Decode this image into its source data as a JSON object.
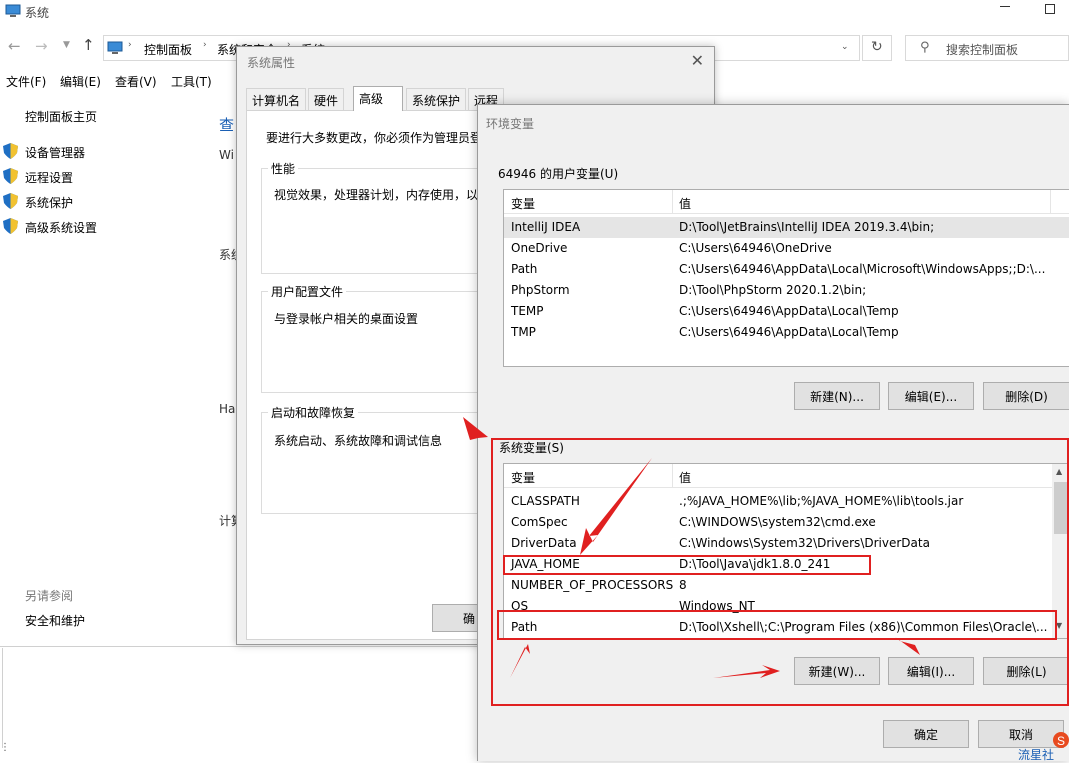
{
  "window": {
    "title": "系统",
    "address_path": [
      "控制面板",
      "系统和安全",
      "系统"
    ],
    "search_placeholder": "搜索控制面板",
    "menu": [
      "文件(F)",
      "编辑(E)",
      "查看(V)",
      "工具(T)"
    ],
    "sidebar_home": "控制面板主页",
    "sidebar_links": [
      "设备管理器",
      "远程设置",
      "系统保护",
      "高级系统设置"
    ],
    "see_also_label": "另请参阅",
    "see_also_links": [
      "安全和维护"
    ],
    "partial_texts": [
      "查",
      "Wi",
      "系统",
      "Ha",
      "计算"
    ]
  },
  "sysprop": {
    "title": "系统属性",
    "tabs": [
      "计算机名",
      "硬件",
      "高级",
      "系统保护",
      "远程"
    ],
    "active_tab": "高级",
    "intro": "要进行大多数更改，你必须作为管理员登",
    "groups": [
      {
        "label": "性能",
        "desc": "视觉效果，处理器计划，内存使用，以"
      },
      {
        "label": "用户配置文件",
        "desc": "与登录帐户相关的桌面设置"
      },
      {
        "label": "启动和故障恢复",
        "desc": "系统启动、系统故障和调试信息"
      }
    ],
    "ok_partial": "确"
  },
  "envvars": {
    "title": "环境变量",
    "user_group_label": "64946 的用户变量(U)",
    "col_var": "变量",
    "col_val": "值",
    "user_vars": [
      {
        "name": "IntelliJ IDEA",
        "value": "D:\\Tool\\JetBrains\\IntelliJ IDEA 2019.3.4\\bin;"
      },
      {
        "name": "OneDrive",
        "value": "C:\\Users\\64946\\OneDrive"
      },
      {
        "name": "Path",
        "value": "C:\\Users\\64946\\AppData\\Local\\Microsoft\\WindowsApps;;D:\\..."
      },
      {
        "name": "PhpStorm",
        "value": "D:\\Tool\\PhpStorm 2020.1.2\\bin;"
      },
      {
        "name": "TEMP",
        "value": "C:\\Users\\64946\\AppData\\Local\\Temp"
      },
      {
        "name": "TMP",
        "value": "C:\\Users\\64946\\AppData\\Local\\Temp"
      }
    ],
    "user_buttons": [
      "新建(N)...",
      "编辑(E)...",
      "删除(D)"
    ],
    "sys_group_label": "系统变量(S)",
    "sys_vars": [
      {
        "name": "CLASSPATH",
        "value": ".;%JAVA_HOME%\\lib;%JAVA_HOME%\\lib\\tools.jar"
      },
      {
        "name": "ComSpec",
        "value": "C:\\WINDOWS\\system32\\cmd.exe"
      },
      {
        "name": "DriverData",
        "value": "C:\\Windows\\System32\\Drivers\\DriverData"
      },
      {
        "name": "JAVA_HOME",
        "value": "D:\\Tool\\Java\\jdk1.8.0_241"
      },
      {
        "name": "NUMBER_OF_PROCESSORS",
        "value": "8"
      },
      {
        "name": "OS",
        "value": "Windows_NT"
      },
      {
        "name": "Path",
        "value": "D:\\Tool\\Xshell\\;C:\\Program Files (x86)\\Common Files\\Oracle\\..."
      }
    ],
    "sys_buttons": [
      "新建(W)...",
      "编辑(I)...",
      "删除(L)"
    ],
    "ok": "确定",
    "cancel": "取消"
  },
  "watermark": "流星社",
  "colors": {
    "highlight": "#e02020",
    "selected_row": "#e5e5e5",
    "link_blue": "#1a5fb4"
  }
}
